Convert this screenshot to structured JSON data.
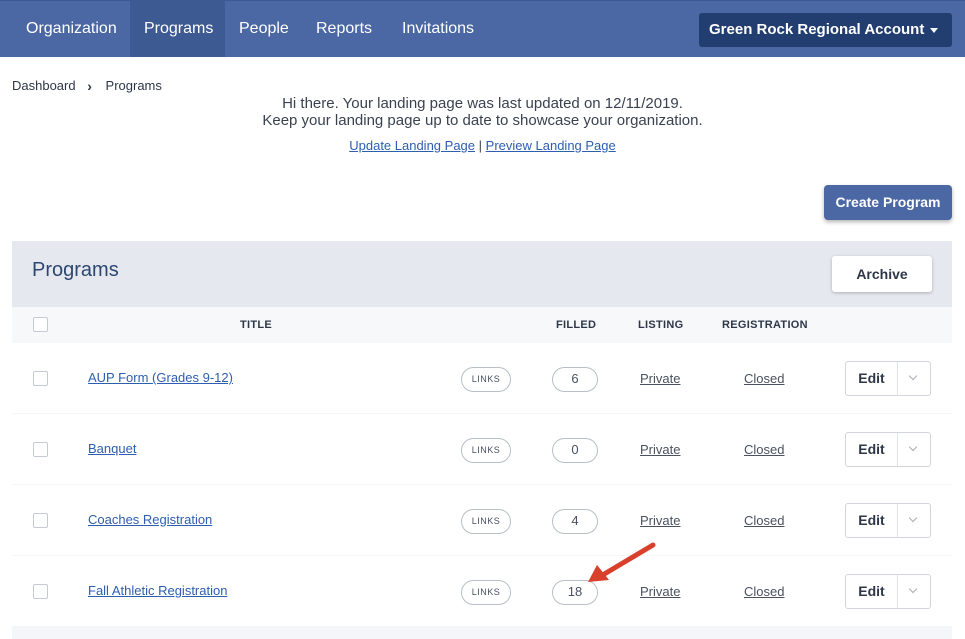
{
  "nav": {
    "items": [
      {
        "label": "Organization",
        "active": false
      },
      {
        "label": "Programs",
        "active": true
      },
      {
        "label": "People",
        "active": false
      },
      {
        "label": "Reports",
        "active": false
      },
      {
        "label": "Invitations",
        "active": false
      }
    ],
    "account": "Green Rock Regional Account"
  },
  "breadcrumb": {
    "items": [
      "Dashboard",
      "Programs"
    ],
    "separator_icon": "chevron-right-icon"
  },
  "notice": {
    "line1": "Hi there. Your landing page was last updated on 12/11/2019.",
    "line2": "Keep your landing page up to date to showcase your organization.",
    "update_link": "Update Landing Page",
    "separator": "|",
    "preview_link": "Preview Landing Page"
  },
  "create_button": "Create Program",
  "programs": {
    "title": "Programs",
    "archive_button": "Archive",
    "columns": {
      "title": "TITLE",
      "filled": "FILLED",
      "listing": "LISTING",
      "registration": "REGISTRATION"
    },
    "rows": [
      {
        "title": "AUP Form (Grades 9-12)",
        "links": "LINKS",
        "filled": "6",
        "listing": "Private",
        "registration": "Closed",
        "edit": "Edit"
      },
      {
        "title": "Banquet",
        "links": "LINKS",
        "filled": "0",
        "listing": "Private",
        "registration": "Closed",
        "edit": "Edit"
      },
      {
        "title": "Coaches Registration",
        "links": "LINKS",
        "filled": "4",
        "listing": "Private",
        "registration": "Closed",
        "edit": "Edit"
      },
      {
        "title": "Fall Athletic Registration",
        "links": "LINKS",
        "filled": "18",
        "listing": "Private",
        "registration": "Closed",
        "edit": "Edit"
      }
    ]
  },
  "colors": {
    "nav": "#4b68a4",
    "nav_active": "#3e5a93",
    "account": "#223d70",
    "link": "#2d5eb0",
    "annotation_arrow": "#d8402b"
  }
}
